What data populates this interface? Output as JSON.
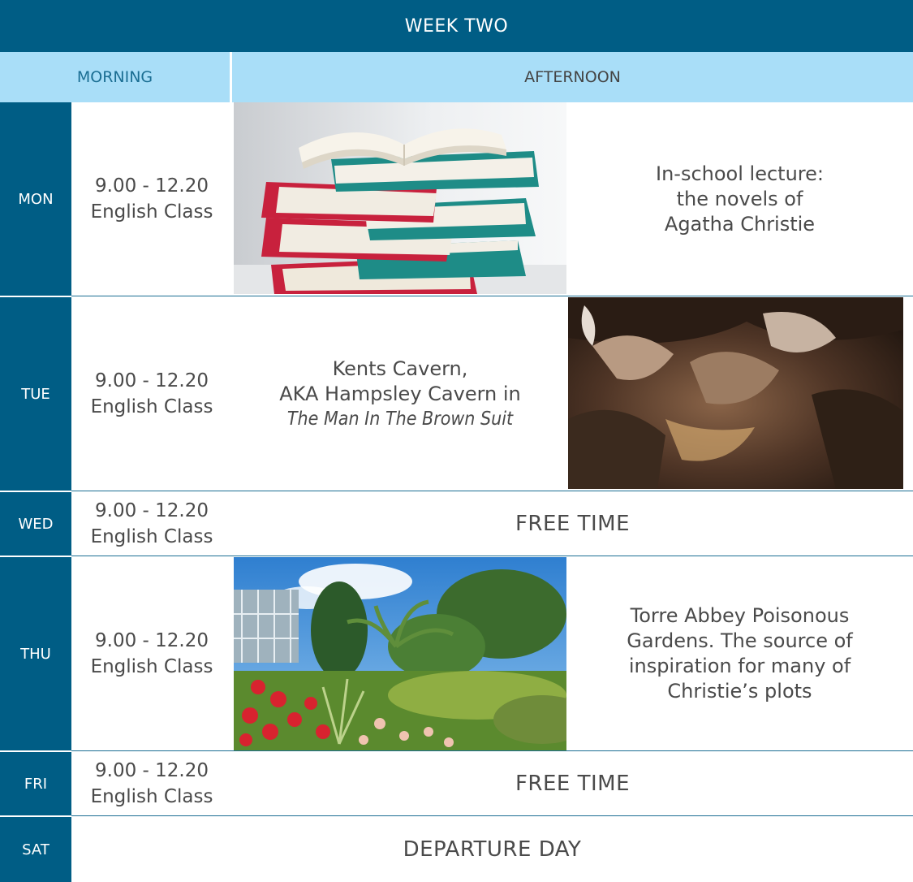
{
  "header": {
    "title": "WEEK TWO",
    "morning_label": "MORNING",
    "afternoon_label": "AFTERNOON"
  },
  "schedule": {
    "mon": {
      "day": "MON",
      "time": "9.00 - 12.20",
      "class": "English Class",
      "afternoon_lines": [
        "In-school lecture:",
        "the novels of",
        "Agatha Christie"
      ],
      "image": "books-photo"
    },
    "tue": {
      "day": "TUE",
      "time": "9.00 - 12.20",
      "class": "English Class",
      "afternoon_lines": [
        "Kents Cavern,",
        "AKA Hampsley Cavern in"
      ],
      "afternoon_italic": "The Man In The Brown Suit",
      "image": "cavern-photo"
    },
    "wed": {
      "day": "WED",
      "time": "9.00 - 12.20",
      "class": "English Class",
      "afternoon": "FREE TIME"
    },
    "thu": {
      "day": "THU",
      "time": "9.00 - 12.20",
      "class": "English Class",
      "afternoon_lines": [
        "Torre Abbey Poisonous",
        "Gardens. The source of",
        "inspiration for many of",
        "Christie’s plots"
      ],
      "image": "garden-photo"
    },
    "fri": {
      "day": "FRI",
      "time": "9.00 - 12.20",
      "class": "English Class",
      "afternoon": "FREE TIME"
    },
    "sat": {
      "day": "SAT",
      "all_day": "DEPARTURE DAY"
    }
  },
  "colors": {
    "dark_blue": "#005d85",
    "light_blue": "#a9def8",
    "text": "#4a4a4a"
  }
}
